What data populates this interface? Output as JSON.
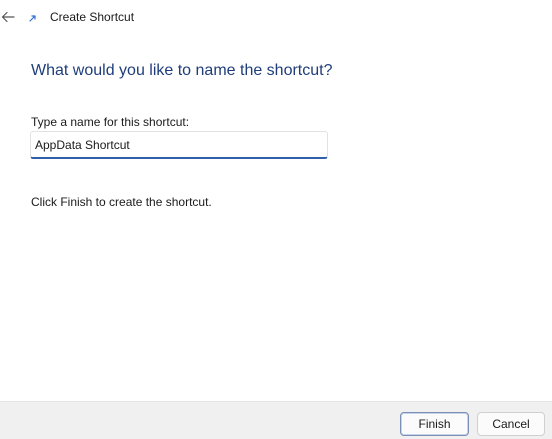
{
  "window": {
    "title": "Create Shortcut"
  },
  "main": {
    "heading": "What would you like to name the shortcut?",
    "name_label": "Type a name for this shortcut:",
    "name_value": "AppData Shortcut",
    "instruction": "Click Finish to create the shortcut."
  },
  "footer": {
    "finish_label": "Finish",
    "cancel_label": "Cancel"
  },
  "icons": {
    "back": "back-arrow-icon",
    "app": "shortcut-icon"
  },
  "colors": {
    "heading": "#1f3d7a",
    "accent": "#2e5fa8",
    "footer_bg": "#f0f0f0"
  }
}
